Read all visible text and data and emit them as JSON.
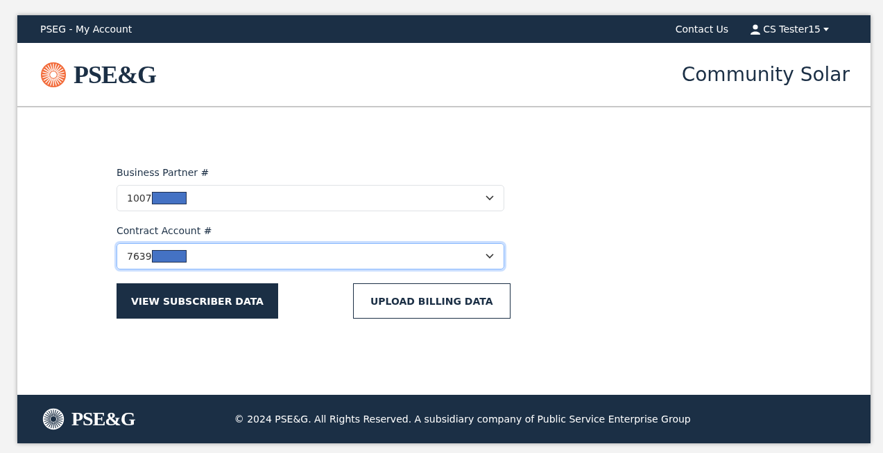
{
  "top_bar": {
    "title": "PSEG - My Account",
    "links": [
      "Contact Us"
    ],
    "user": {
      "name": "CS Tester15"
    }
  },
  "header": {
    "logo_text": "PSE&G",
    "page_title": "Community Solar"
  },
  "form": {
    "fields": [
      {
        "label": "Business Partner #",
        "value": "1007",
        "redacted": true,
        "focused": false
      },
      {
        "label": "Contract Account #",
        "value": "7639",
        "redacted": true,
        "focused": true
      }
    ],
    "buttons": [
      {
        "label": "VIEW SUBSCRIBER DATA",
        "kind": "primary"
      },
      {
        "label": "UPLOAD BILLING DATA",
        "kind": "outline"
      }
    ]
  },
  "footer": {
    "logo_text": "PSE&G",
    "copyright": "© 2024 PSE&G. All Rights Reserved. A subsidiary company of Public Service Enterprise Group"
  }
}
